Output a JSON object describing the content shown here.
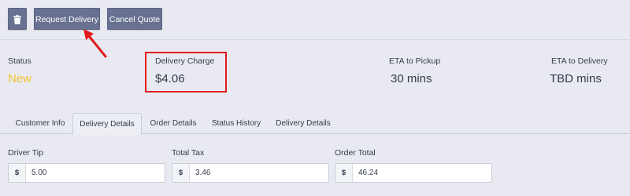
{
  "toolbar": {
    "trash_icon": "trash-icon",
    "request_delivery_label": "Request Delivery",
    "cancel_quote_label": "Cancel Quote"
  },
  "stats": {
    "status_label": "Status",
    "status_value": "New",
    "delivery_charge_label": "Delivery Charge",
    "delivery_charge_value": "$4.06",
    "eta_pickup_label": "ETA to Pickup",
    "eta_pickup_value": "30 mins",
    "eta_delivery_label": "ETA to Delivery",
    "eta_delivery_value": "TBD mins"
  },
  "tabs": [
    {
      "label": "Customer Info",
      "active": false
    },
    {
      "label": "Delivery Details",
      "active": true
    },
    {
      "label": "Order Details",
      "active": false
    },
    {
      "label": "Status History",
      "active": false
    },
    {
      "label": "Delivery Details",
      "active": false
    }
  ],
  "fields": {
    "driver_tip": {
      "label": "Driver Tip",
      "prefix": "$",
      "value": "5.00"
    },
    "total_tax": {
      "label": "Total Tax",
      "prefix": "$",
      "value": "3.46"
    },
    "order_total": {
      "label": "Order Total",
      "prefix": "$",
      "value": "46.24"
    }
  },
  "colors": {
    "background": "#e9eaf1",
    "button": "#687191",
    "status_new": "#f0c330",
    "annotation_red": "#e01b1b"
  }
}
